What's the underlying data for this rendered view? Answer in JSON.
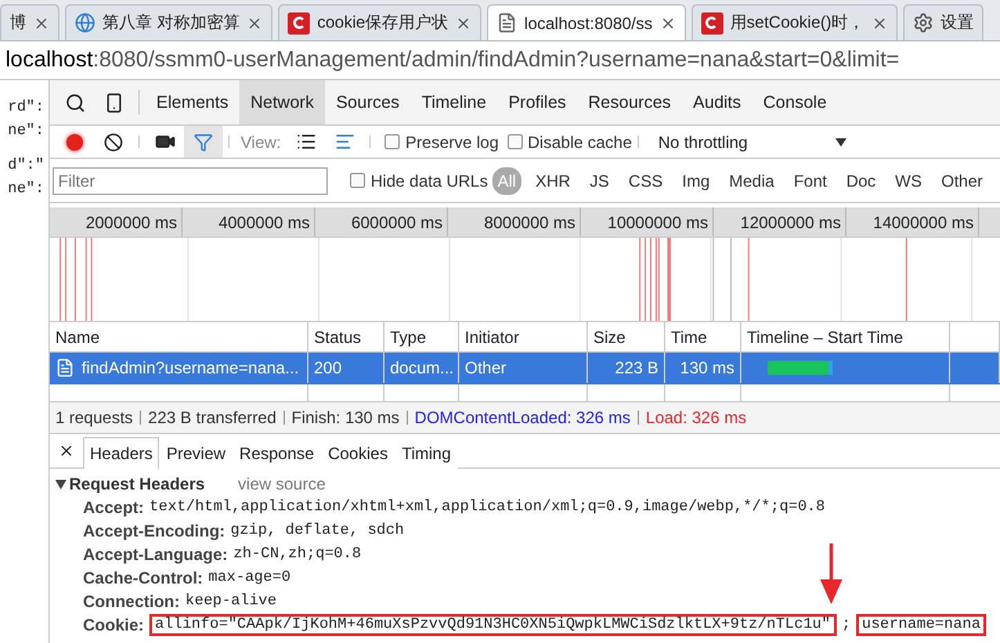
{
  "browser_tabs": [
    {
      "title": "博",
      "kind": "plain",
      "selected": false
    },
    {
      "title": "第八章 对称加密算",
      "kind": "globe",
      "selected": false
    },
    {
      "title": "cookie保存用户状",
      "kind": "site",
      "selected": false
    },
    {
      "title": "localhost:8080/ss",
      "kind": "page",
      "selected": true
    },
    {
      "title": "用setCookie()时，",
      "kind": "site",
      "selected": false
    },
    {
      "title": "设置",
      "kind": "settings",
      "selected": false
    }
  ],
  "address": {
    "host": "localhost",
    "rest": ":8080/ssmm0-userManagement/admin/findAdmin?username=nana&start=0&limit="
  },
  "page_text": [
    "rd\":",
    "ne\":",
    "d\":\"",
    "ne\":"
  ],
  "panel_tabs": [
    {
      "label": "Elements",
      "selected": false
    },
    {
      "label": "Network",
      "selected": true
    },
    {
      "label": "Sources",
      "selected": false
    },
    {
      "label": "Timeline",
      "selected": false
    },
    {
      "label": "Profiles",
      "selected": false
    },
    {
      "label": "Resources",
      "selected": false
    },
    {
      "label": "Audits",
      "selected": false
    },
    {
      "label": "Console",
      "selected": false
    }
  ],
  "toolbar": {
    "recording": true,
    "filter_active": true,
    "view_label": "View:",
    "checkboxes": [
      {
        "label": "Preserve log",
        "checked": false
      },
      {
        "label": "Disable cache",
        "checked": false
      }
    ],
    "throttling": "No throttling"
  },
  "filter_bar": {
    "placeholder": "Filter",
    "hide_data_urls": {
      "label": "Hide data URLs",
      "checked": false
    },
    "types": [
      {
        "label": "All",
        "selected": true
      },
      {
        "label": "XHR",
        "selected": false
      },
      {
        "label": "JS",
        "selected": false
      },
      {
        "label": "CSS",
        "selected": false
      },
      {
        "label": "Img",
        "selected": false
      },
      {
        "label": "Media",
        "selected": false
      },
      {
        "label": "Font",
        "selected": false
      },
      {
        "label": "Doc",
        "selected": false
      },
      {
        "label": "WS",
        "selected": false
      },
      {
        "label": "Other",
        "selected": false
      }
    ]
  },
  "timeline_ticks": [
    "2000000 ms",
    "4000000 ms",
    "6000000 ms",
    "8000000 ms",
    "10000000 ms",
    "12000000 ms",
    "14000000 ms"
  ],
  "table": {
    "columns": [
      "Name",
      "Status",
      "Type",
      "Initiator",
      "Size",
      "Time",
      "Timeline – Start Time"
    ],
    "rows": [
      {
        "name": "findAdmin?username=nana...",
        "status": "200",
        "type": "docum...",
        "initiator": "Other",
        "size": "223 B",
        "time": "130 ms",
        "selected": true
      }
    ]
  },
  "summary": [
    {
      "text": "1 requests",
      "kind": "plain"
    },
    {
      "text": "223 B transferred",
      "kind": "plain"
    },
    {
      "text": "Finish: 130 ms",
      "kind": "plain"
    },
    {
      "text": "DOMContentLoaded: 326 ms",
      "kind": "dom"
    },
    {
      "text": "Load: 326 ms",
      "kind": "load"
    }
  ],
  "detail_tabs": [
    {
      "label": "Headers",
      "selected": true
    },
    {
      "label": "Preview",
      "selected": false
    },
    {
      "label": "Response",
      "selected": false
    },
    {
      "label": "Cookies",
      "selected": false
    },
    {
      "label": "Timing",
      "selected": false
    }
  ],
  "request_headers": {
    "title": "Request Headers",
    "expanded": true,
    "link": "view source",
    "items": [
      {
        "name": "Accept:",
        "parts": [
          {
            "text": "text/html,application/xhtml+xml,application/xml;q=0.9,image/webp,*/*;q=0.8",
            "boxed": false
          }
        ]
      },
      {
        "name": "Accept-Encoding:",
        "parts": [
          {
            "text": "gzip, deflate, sdch",
            "boxed": false
          }
        ]
      },
      {
        "name": "Accept-Language:",
        "parts": [
          {
            "text": "zh-CN,zh;q=0.8",
            "boxed": false
          }
        ]
      },
      {
        "name": "Cache-Control:",
        "parts": [
          {
            "text": "max-age=0",
            "boxed": false
          }
        ]
      },
      {
        "name": "Connection:",
        "parts": [
          {
            "text": "keep-alive",
            "boxed": false
          }
        ]
      },
      {
        "name": "Cookie:",
        "parts": [
          {
            "text": "allinfo=\"CAApk/IjKohM+46muXsPzvvQd91N3HC0XN5iQwpkLMWCiSdzlktLX+9tz/nTLc1u\"",
            "boxed": true
          },
          {
            "text": ";",
            "boxed": false
          },
          {
            "text": "username=nana",
            "boxed": true
          }
        ]
      }
    ]
  }
}
